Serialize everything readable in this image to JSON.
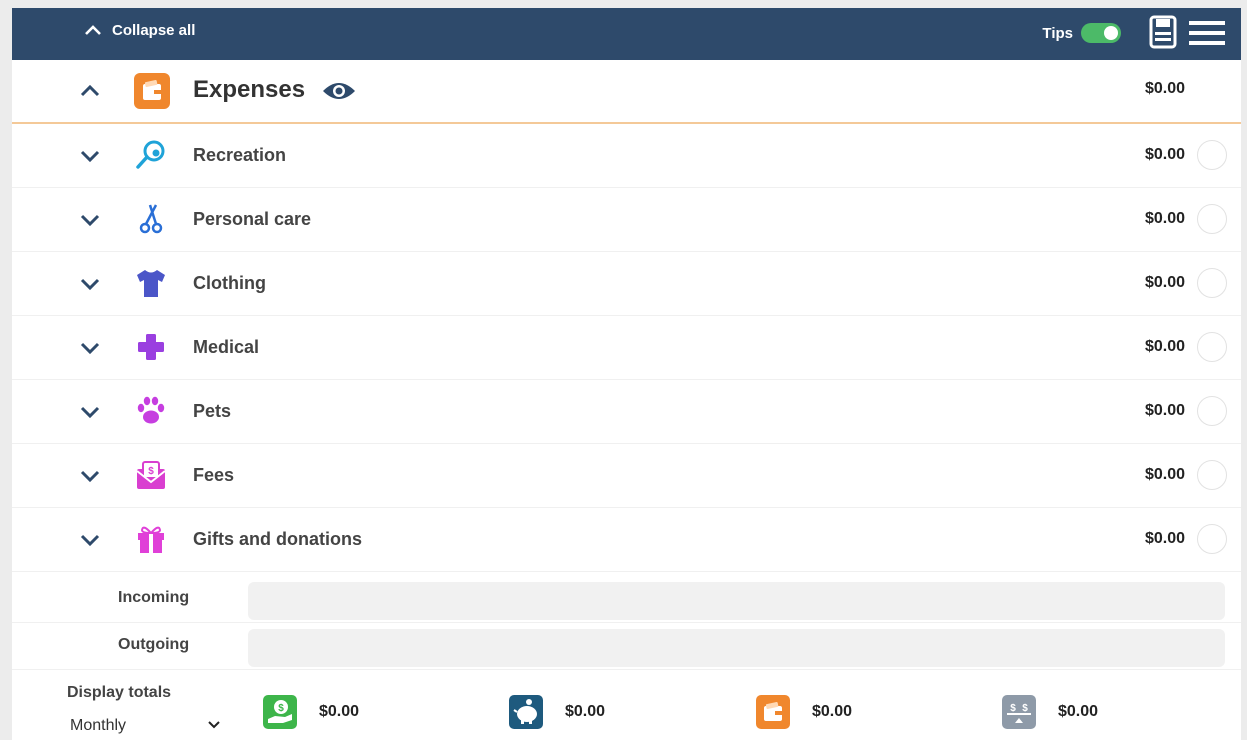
{
  "toolbar": {
    "collapse_label": "Collapse all",
    "tips_label": "Tips",
    "tips_on": true
  },
  "expenses": {
    "title": "Expenses",
    "total": "$0.00"
  },
  "categories": [
    {
      "label": "Recreation",
      "total": "$0.00",
      "icon": "magnifier-icon",
      "color": "#1fa3d8"
    },
    {
      "label": "Personal care",
      "total": "$0.00",
      "icon": "scissors-icon",
      "color": "#2a6fd6"
    },
    {
      "label": "Clothing",
      "total": "$0.00",
      "icon": "shirt-icon",
      "color": "#4b56c8"
    },
    {
      "label": "Medical",
      "total": "$0.00",
      "icon": "medical-cross-icon",
      "color": "#9a3fe0"
    },
    {
      "label": "Pets",
      "total": "$0.00",
      "icon": "paw-icon",
      "color": "#c63ee0"
    },
    {
      "label": "Fees",
      "total": "$0.00",
      "icon": "envelope-dollar-icon",
      "color": "#d93fd0"
    },
    {
      "label": "Gifts and donations",
      "total": "$0.00",
      "icon": "gift-icon",
      "color": "#e040d8"
    }
  ],
  "subrows": {
    "incoming": "Incoming",
    "outgoing": "Outgoing"
  },
  "display_totals": {
    "label": "Display totals",
    "selected": "Monthly"
  },
  "totals": [
    {
      "icon": "income-hand-icon",
      "value": "$0.00",
      "color": "#3db54a"
    },
    {
      "icon": "piggy-bank-icon",
      "value": "$0.00",
      "color": "#1e5a7e"
    },
    {
      "icon": "wallet-icon",
      "value": "$0.00",
      "color": "#f0872d"
    },
    {
      "icon": "balance-icon",
      "value": "$0.00",
      "color": "#8e9aa8"
    }
  ]
}
